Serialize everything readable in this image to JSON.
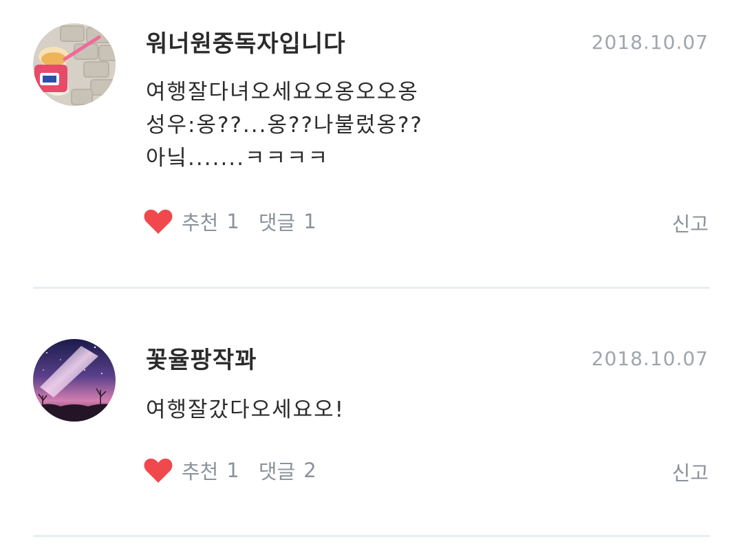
{
  "comments": [
    {
      "username": "워너원중독자입니다",
      "date": "2018.10.07",
      "lines": [
        "여행잘다녀오세요오옹오오옹",
        "성우:옹??...옹??나불렀옹??",
        "아닠.......ㅋㅋㅋㅋ"
      ],
      "recommend_label": "추천",
      "recommend_count": "1",
      "reply_label": "댓글",
      "reply_count": "1",
      "report_label": "신고"
    },
    {
      "username": "꽃율팡작꽈",
      "date": "2018.10.07",
      "lines": [
        "여행잘갔다오세요오!"
      ],
      "recommend_label": "추천",
      "recommend_count": "1",
      "reply_label": "댓글",
      "reply_count": "2",
      "report_label": "신고"
    }
  ],
  "colors": {
    "heart": "#f0484c",
    "meta_text": "#8b9299",
    "date_text": "#9ea5ad",
    "divider": "#e8edf1"
  },
  "icons": {
    "like": "heart-icon",
    "avatar_1": "ice-cream-photo",
    "avatar_2": "night-sky-photo"
  }
}
